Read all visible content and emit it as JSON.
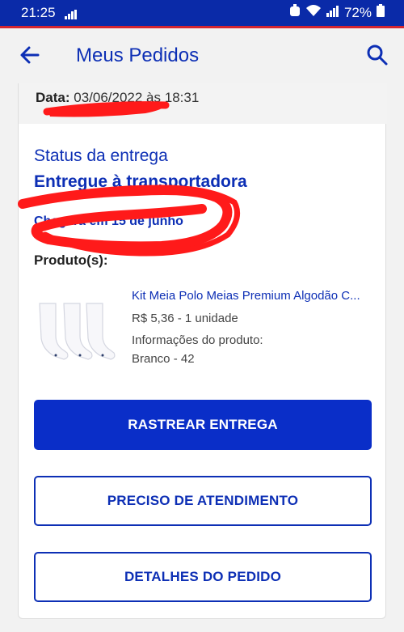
{
  "status_bar": {
    "time": "21:25",
    "battery": "72%"
  },
  "header": {
    "title": "Meus Pedidos"
  },
  "order": {
    "date_label": "Data:",
    "date_value": "03/06/2022 às 18:31",
    "status_label": "Status da entrega",
    "status_value": "Entregue à transportadora",
    "eta": "Chegará em 15 de junho",
    "products_label": "Produto(s):"
  },
  "product": {
    "name": "Kit Meia Polo Meias Premium Algodão C...",
    "price_qty": "R$ 5,36 - 1 unidade",
    "info_label": "Informações do produto:",
    "variant": "Branco - 42"
  },
  "buttons": {
    "track": "RASTREAR ENTREGA",
    "support": "PRECISO DE ATENDIMENTO",
    "details": "DETALHES DO PEDIDO"
  },
  "colors": {
    "brand_blue": "#0d2fb5",
    "status_bar": "#0a2aa8",
    "accent_red": "#d32531",
    "scribble_red": "#ff0000"
  }
}
